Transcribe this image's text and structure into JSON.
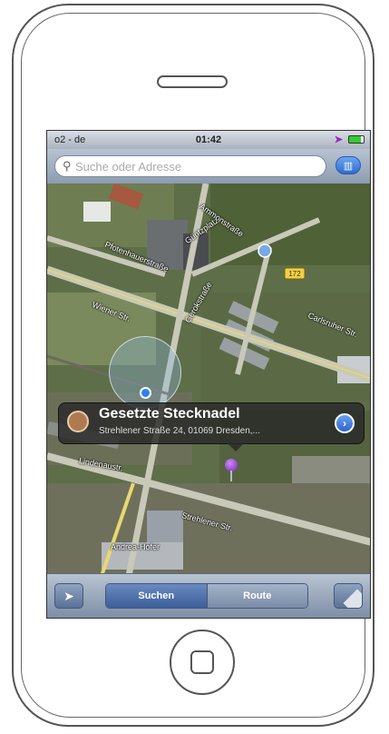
{
  "status_bar": {
    "carrier": "o2 - de",
    "time": "01:42"
  },
  "search": {
    "placeholder": "Suche oder Adresse"
  },
  "map": {
    "street_labels": [
      "Pfotenhauerstraße",
      "Güntzplatz",
      "Wiener Str.",
      "Gerokstraße",
      "Strehlener Str.",
      "Carlsruher Str.",
      "Ammonstraße",
      "Andrea-Hofer",
      "Lindenaustr."
    ],
    "road_shield": "172"
  },
  "callout": {
    "title": "Gesetzte Stecknadel",
    "subtitle": "Strehlener Straße 24, 01069 Dresden,...",
    "detail_icon": "chevron-right-icon"
  },
  "toolbar": {
    "segments": [
      "Suchen",
      "Route"
    ],
    "active_segment": "Suchen"
  },
  "colors": {
    "user_location": "#2f7ff0",
    "pin": "#7a22b8",
    "toolbar_active": "#3c5e9a"
  }
}
